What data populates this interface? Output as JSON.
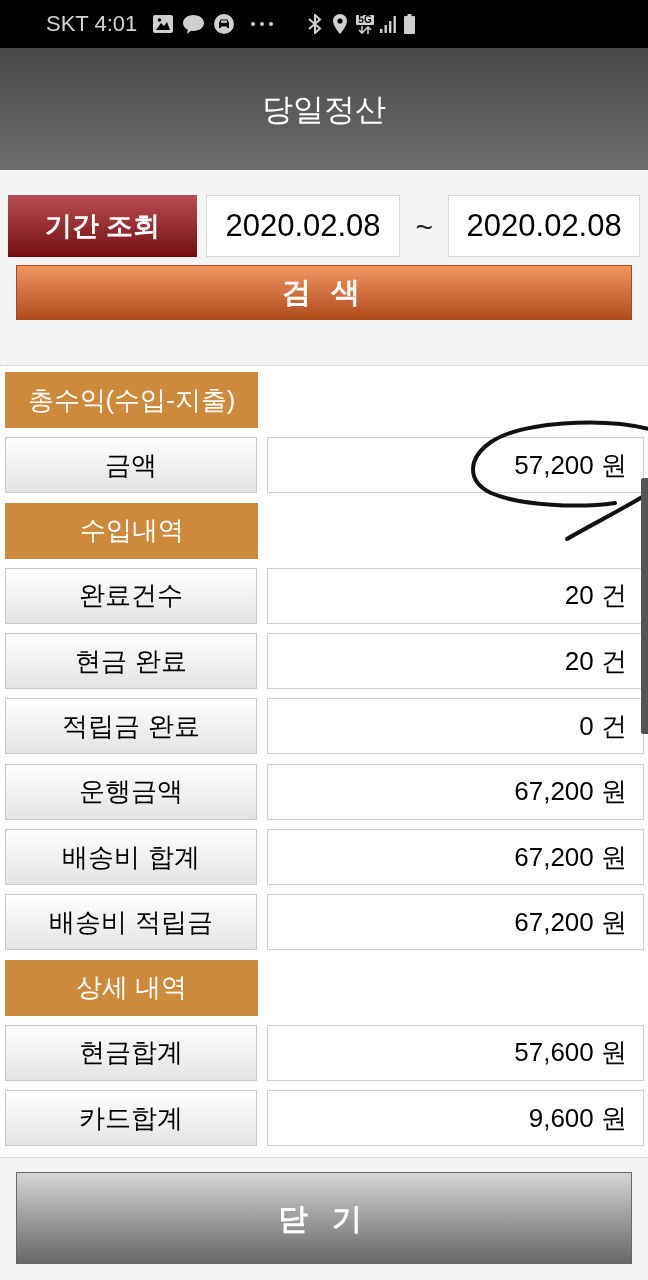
{
  "status_bar": {
    "carrier_time": "SKT 4:01",
    "network": "5G"
  },
  "header": {
    "title": "당일정산"
  },
  "period": {
    "button": "기간 조회",
    "start_date": "2020.02.08",
    "separator": "~",
    "end_date": "2020.02.08"
  },
  "search_button": "검 색",
  "sections": [
    {
      "title": "총수익(수입-지출)",
      "rows": [
        {
          "label": "금액",
          "value": "57,200 원",
          "circled": true
        }
      ]
    },
    {
      "title": "수입내역",
      "rows": [
        {
          "label": "완료건수",
          "value": "20 건",
          "circled": false
        },
        {
          "label": "현금 완료",
          "value": "20 건",
          "circled": false
        },
        {
          "label": "적립금 완료",
          "value": "0 건",
          "circled": false
        },
        {
          "label": "운행금액",
          "value": "67,200 원",
          "circled": false
        },
        {
          "label": "배송비 합계",
          "value": "67,200 원",
          "circled": false
        },
        {
          "label": "배송비 적립금",
          "value": "67,200 원",
          "circled": false
        }
      ]
    },
    {
      "title": "상세 내역",
      "rows": [
        {
          "label": "현금합계",
          "value": "57,600 원",
          "circled": false
        },
        {
          "label": "카드합계",
          "value": "9,600 원",
          "circled": false
        }
      ]
    }
  ],
  "close_button": "닫 기"
}
